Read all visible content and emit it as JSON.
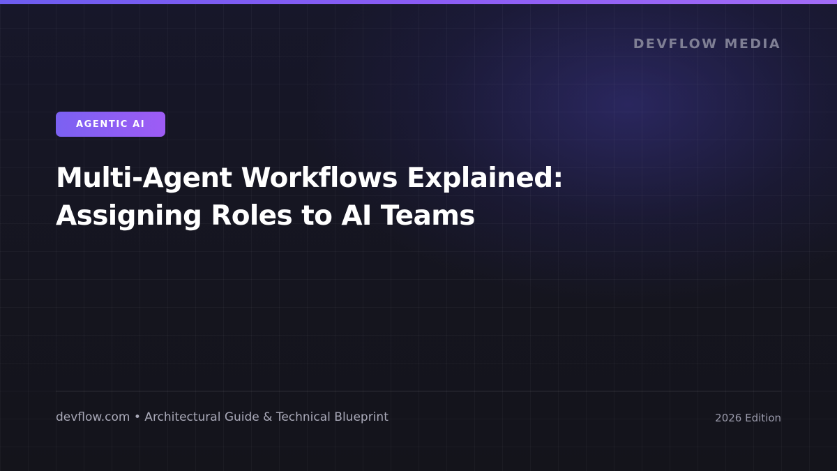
{
  "brand": {
    "name": "DEVFLOW MEDIA"
  },
  "badge": {
    "label": "AGENTIC AI"
  },
  "headline": {
    "line1": "Multi-Agent Workflows Explained:",
    "line2": "Assigning Roles to AI Teams"
  },
  "footer": {
    "site_info": "devflow.com • Architectural Guide & Technical Blueprint",
    "edition": "2026 Edition"
  },
  "colors": {
    "accent_start": "#7b61f2",
    "accent_end": "#9e5cf5",
    "background": "#14141d",
    "headline": "#ffffff",
    "muted_text": "#a9a9b8"
  }
}
